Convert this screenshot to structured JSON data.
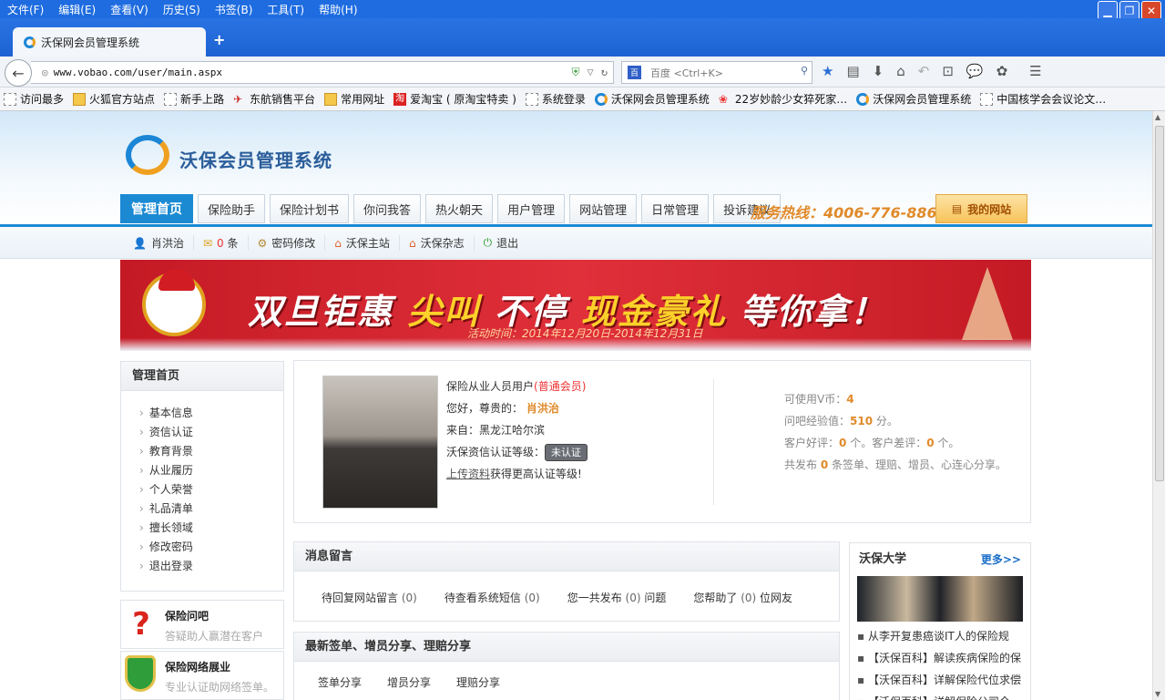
{
  "browser": {
    "menu": [
      "文件(F)",
      "编辑(E)",
      "查看(V)",
      "历史(S)",
      "书签(B)",
      "工具(T)",
      "帮助(H)"
    ],
    "tab_title": "沃保网会员管理系统",
    "url": "www.vobao.com/user/main.aspx",
    "search_placeholder": "百度 <Ctrl+K>",
    "search_engine_badge": "百",
    "bookmarks": [
      {
        "label": "访问最多",
        "icon": "search-page-icon"
      },
      {
        "label": "火狐官方站点",
        "icon": "folder-icon"
      },
      {
        "label": "新手上路",
        "icon": "page-icon"
      },
      {
        "label": "东航销售平台",
        "icon": "plane-icon"
      },
      {
        "label": "常用网址",
        "icon": "folder-icon"
      },
      {
        "label": "爱淘宝 ( 原淘宝特卖 )",
        "icon": "taobao-icon"
      },
      {
        "label": "系统登录",
        "icon": "page-icon"
      },
      {
        "label": "沃保网会员管理系统",
        "icon": "firefox-icon"
      },
      {
        "label": "22岁妙龄少女猝死家…",
        "icon": "news-icon"
      },
      {
        "label": "沃保网会员管理系统",
        "icon": "firefox-icon"
      },
      {
        "label": "中国核学会会议论文…",
        "icon": "page-icon"
      }
    ]
  },
  "site": {
    "logo_text": "沃保会员管理系统",
    "nav": [
      "管理首页",
      "保险助手",
      "保险计划书",
      "你问我答",
      "热火朝天",
      "用户管理",
      "网站管理",
      "日常管理",
      "投诉建议"
    ],
    "hotline": "服务热线：4006-776-886",
    "my_site": "我的网站",
    "userbar": {
      "name": "肖洪治",
      "msg_count": "0",
      "msg_unit": "条",
      "change_pwd": "密码修改",
      "main_site": "沃保主站",
      "magazine": "沃保杂志",
      "logout": "退出"
    },
    "banner": {
      "part1": "双旦钜惠 ",
      "part2": "尖叫",
      "part3": " 不停 ",
      "part4": "现金豪礼",
      "part5": " 等你拿！",
      "sub": "活动时间：2014年12月20日-2014年12月31日"
    },
    "sidebar": {
      "title": "管理首页",
      "items": [
        "基本信息",
        "资信认证",
        "教育背景",
        "从业履历",
        "个人荣誉",
        "礼品清单",
        "擅长领域",
        "修改密码",
        "退出登录"
      ]
    },
    "promos": [
      {
        "title": "保险问吧",
        "sub": "答疑助人赢潜在客户"
      },
      {
        "title": "保险网络展业",
        "sub": "专业认证助网络签单。"
      }
    ],
    "profile": {
      "user_type": "保险从业人员用户",
      "member_level": "(普通会员)",
      "greeting": "您好，尊贵的：",
      "name": "肖洪治",
      "from_label": "来自：",
      "from": "黑龙江哈尔滨",
      "cert_label": "沃保资信认证等级：",
      "cert_badge": "未认证",
      "upload_link": "上传资料",
      "upload_suffix": "获得更高认证等级!",
      "vcoin_label": "可使用V币：",
      "vcoin": "4",
      "exp_label": "问吧经验值：",
      "exp": "510",
      "exp_unit": "分。",
      "good_label": "客户好评：",
      "good": "0",
      "good_unit": "个。",
      "bad_label": "客户差评：",
      "bad": "0",
      "bad_unit": "个。",
      "pub_prefix": "共发布",
      "pub": "0",
      "pub_suffix": "条签单、理赔、增员、心连心分享。"
    },
    "messages": {
      "title": "消息留言",
      "items": [
        {
          "label": "待回复网站留言",
          "count": "(0)",
          "suffix": ""
        },
        {
          "label": "待查看系统短信",
          "count": "(0)",
          "suffix": ""
        },
        {
          "label": "您一共发布",
          "count": "(0)",
          "suffix": "问题"
        },
        {
          "label": "您帮助了",
          "count": "(0)",
          "suffix": "位网友"
        }
      ]
    },
    "latest": {
      "title": "最新签单、增员分享、理赔分享",
      "tabs": [
        "签单分享",
        "增员分享",
        "理赔分享"
      ]
    },
    "university": {
      "title": "沃保大学",
      "more": "更多>>",
      "items": [
        "从李开复患癌谈IT人的保险规",
        "【沃保百科】解读疾病保险的保",
        "【沃保百科】详解保险代位求偿",
        "【沃保百科】详解保险公司全"
      ]
    }
  }
}
